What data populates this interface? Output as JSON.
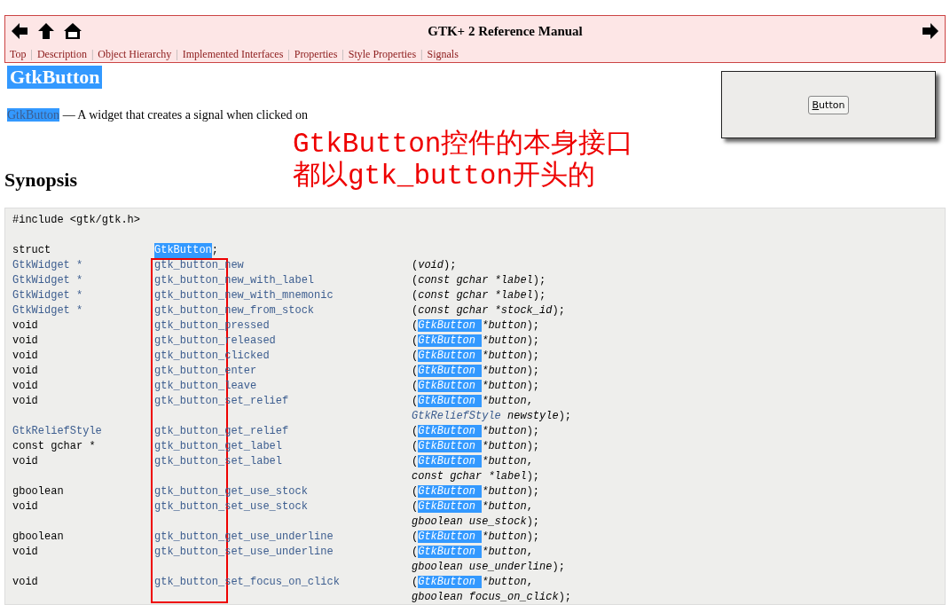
{
  "header": {
    "title": "GTK+ 2 Reference Manual",
    "nav_separator": "|",
    "nav": [
      "Top",
      "Description",
      "Object Hierarchy",
      "Implemented Interfaces",
      "Properties",
      "Style Properties",
      "Signals"
    ]
  },
  "heading": {
    "text": "GtkButton",
    "selected": true
  },
  "description": {
    "link": "GtkButton",
    "link_selected": true,
    "text": "— A widget that creates a signal when clicked on"
  },
  "preview": {
    "button_label": "Button",
    "mnemonic_underlined": true
  },
  "annotation": {
    "lines": [
      "GtkButton控件的本身接口",
      "都以gtk_button开头的"
    ],
    "frame": true
  },
  "synopsis": {
    "title": "Synopsis",
    "lines": [
      {
        "kind": "include",
        "text": "#include <gtk/gtk.h>"
      },
      {
        "kind": "blank"
      },
      {
        "kind": "struct",
        "type": "struct",
        "name": "GtkButton",
        "name_selected": true,
        "suffix": ";"
      },
      {
        "kind": "func",
        "type": "GtkWidget *",
        "type_link": true,
        "name": "gtk_button_new",
        "args": [
          {
            "kind": "punct",
            "text": "("
          },
          {
            "kind": "param",
            "text": "void"
          },
          {
            "kind": "punct",
            "text": ");"
          }
        ]
      },
      {
        "kind": "func",
        "type": "GtkWidget *",
        "type_link": true,
        "name": "gtk_button_new_with_label",
        "args": [
          {
            "kind": "punct",
            "text": "("
          },
          {
            "kind": "param",
            "text": "const gchar *label"
          },
          {
            "kind": "punct",
            "text": ");"
          }
        ]
      },
      {
        "kind": "func",
        "type": "GtkWidget *",
        "type_link": true,
        "name": "gtk_button_new_with_mnemonic",
        "args": [
          {
            "kind": "punct",
            "text": "("
          },
          {
            "kind": "param",
            "text": "const gchar *label"
          },
          {
            "kind": "punct",
            "text": ");"
          }
        ]
      },
      {
        "kind": "func",
        "type": "GtkWidget *",
        "type_link": true,
        "name": "gtk_button_new_from_stock",
        "args": [
          {
            "kind": "punct",
            "text": "("
          },
          {
            "kind": "param",
            "text": "const gchar *stock_id"
          },
          {
            "kind": "punct",
            "text": ");"
          }
        ]
      },
      {
        "kind": "func",
        "type": "void",
        "type_link": false,
        "name": "gtk_button_pressed",
        "args": [
          {
            "kind": "punct",
            "text": "("
          },
          {
            "kind": "selected-type",
            "text": "GtkButton"
          },
          {
            "kind": "param",
            "text": " *button"
          },
          {
            "kind": "punct",
            "text": ");"
          }
        ]
      },
      {
        "kind": "func",
        "type": "void",
        "type_link": false,
        "name": "gtk_button_released",
        "args": [
          {
            "kind": "punct",
            "text": "("
          },
          {
            "kind": "selected-type",
            "text": "GtkButton"
          },
          {
            "kind": "param",
            "text": " *button"
          },
          {
            "kind": "punct",
            "text": ");"
          }
        ]
      },
      {
        "kind": "func",
        "type": "void",
        "type_link": false,
        "name": "gtk_button_clicked",
        "args": [
          {
            "kind": "punct",
            "text": "("
          },
          {
            "kind": "selected-type",
            "text": "GtkButton"
          },
          {
            "kind": "param",
            "text": " *button"
          },
          {
            "kind": "punct",
            "text": ");"
          }
        ]
      },
      {
        "kind": "func",
        "type": "void",
        "type_link": false,
        "name": "gtk_button_enter",
        "args": [
          {
            "kind": "punct",
            "text": "("
          },
          {
            "kind": "selected-type",
            "text": "GtkButton"
          },
          {
            "kind": "param",
            "text": " *button"
          },
          {
            "kind": "punct",
            "text": ");"
          }
        ]
      },
      {
        "kind": "func",
        "type": "void",
        "type_link": false,
        "name": "gtk_button_leave",
        "args": [
          {
            "kind": "punct",
            "text": "("
          },
          {
            "kind": "selected-type",
            "text": "GtkButton"
          },
          {
            "kind": "param",
            "text": " *button"
          },
          {
            "kind": "punct",
            "text": ");"
          }
        ]
      },
      {
        "kind": "func",
        "type": "void",
        "type_link": false,
        "name": "gtk_button_set_relief",
        "args": [
          {
            "kind": "punct",
            "text": "("
          },
          {
            "kind": "selected-type",
            "text": "GtkButton"
          },
          {
            "kind": "param",
            "text": " *button"
          },
          {
            "kind": "punct",
            "text": ","
          }
        ]
      },
      {
        "kind": "cont",
        "args": [
          {
            "kind": "type",
            "text": "GtkReliefStyle"
          },
          {
            "kind": "param",
            "text": " newstyle"
          },
          {
            "kind": "punct",
            "text": ");"
          }
        ]
      },
      {
        "kind": "func",
        "type": "GtkReliefStyle",
        "type_link": true,
        "name": "gtk_button_get_relief",
        "args": [
          {
            "kind": "punct",
            "text": "("
          },
          {
            "kind": "selected-type",
            "text": "GtkButton"
          },
          {
            "kind": "param",
            "text": " *button"
          },
          {
            "kind": "punct",
            "text": ");"
          }
        ]
      },
      {
        "kind": "func",
        "type": "const gchar *",
        "type_link": false,
        "name": "gtk_button_get_label",
        "args": [
          {
            "kind": "punct",
            "text": "("
          },
          {
            "kind": "selected-type",
            "text": "GtkButton"
          },
          {
            "kind": "param",
            "text": " *button"
          },
          {
            "kind": "punct",
            "text": ");"
          }
        ]
      },
      {
        "kind": "func",
        "type": "void",
        "type_link": false,
        "name": "gtk_button_set_label",
        "args": [
          {
            "kind": "punct",
            "text": "("
          },
          {
            "kind": "selected-type",
            "text": "GtkButton"
          },
          {
            "kind": "param",
            "text": " *button"
          },
          {
            "kind": "punct",
            "text": ","
          }
        ]
      },
      {
        "kind": "cont",
        "args": [
          {
            "kind": "param",
            "text": "const gchar *label"
          },
          {
            "kind": "punct",
            "text": ");"
          }
        ]
      },
      {
        "kind": "func",
        "type": "gboolean",
        "type_link": false,
        "name": "gtk_button_get_use_stock",
        "args": [
          {
            "kind": "punct",
            "text": "("
          },
          {
            "kind": "selected-type",
            "text": "GtkButton"
          },
          {
            "kind": "param",
            "text": " *button"
          },
          {
            "kind": "punct",
            "text": ");"
          }
        ]
      },
      {
        "kind": "func",
        "type": "void",
        "type_link": false,
        "name": "gtk_button_set_use_stock",
        "args": [
          {
            "kind": "punct",
            "text": "("
          },
          {
            "kind": "selected-type",
            "text": "GtkButton"
          },
          {
            "kind": "param",
            "text": " *button"
          },
          {
            "kind": "punct",
            "text": ","
          }
        ]
      },
      {
        "kind": "cont",
        "args": [
          {
            "kind": "param",
            "text": "gboolean use_stock"
          },
          {
            "kind": "punct",
            "text": ");"
          }
        ]
      },
      {
        "kind": "func",
        "type": "gboolean",
        "type_link": false,
        "name": "gtk_button_get_use_underline",
        "args": [
          {
            "kind": "punct",
            "text": "("
          },
          {
            "kind": "selected-type",
            "text": "GtkButton"
          },
          {
            "kind": "param",
            "text": " *button"
          },
          {
            "kind": "punct",
            "text": ");"
          }
        ]
      },
      {
        "kind": "func",
        "type": "void",
        "type_link": false,
        "name": "gtk_button_set_use_underline",
        "args": [
          {
            "kind": "punct",
            "text": "("
          },
          {
            "kind": "selected-type",
            "text": "GtkButton"
          },
          {
            "kind": "param",
            "text": " *button"
          },
          {
            "kind": "punct",
            "text": ","
          }
        ]
      },
      {
        "kind": "cont",
        "args": [
          {
            "kind": "param",
            "text": "gboolean use_underline"
          },
          {
            "kind": "punct",
            "text": ");"
          }
        ]
      },
      {
        "kind": "func",
        "type": "void",
        "type_link": false,
        "name": "gtk_button_set_focus_on_click",
        "args": [
          {
            "kind": "punct",
            "text": "("
          },
          {
            "kind": "selected-type",
            "text": "GtkButton"
          },
          {
            "kind": "param",
            "text": " *button"
          },
          {
            "kind": "punct",
            "text": ","
          }
        ]
      },
      {
        "kind": "cont",
        "args": [
          {
            "kind": "param",
            "text": "gboolean focus_on_click"
          },
          {
            "kind": "punct",
            "text": ");"
          }
        ]
      }
    ]
  }
}
